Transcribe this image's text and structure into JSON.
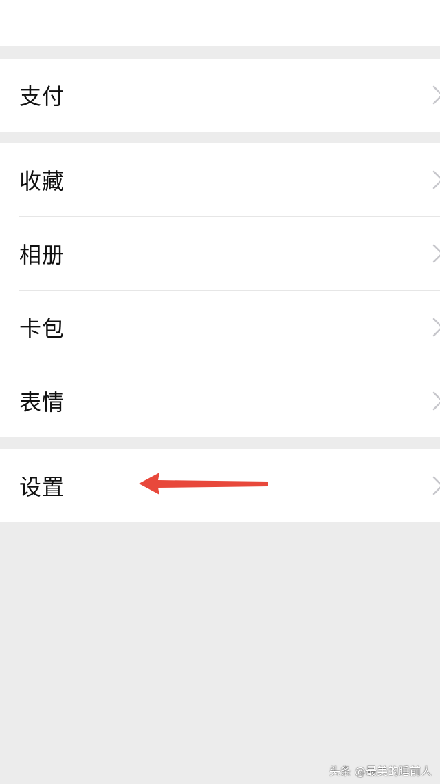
{
  "menu": {
    "pay": "支付",
    "favorites": "收藏",
    "album": "相册",
    "cards": "卡包",
    "stickers": "表情",
    "settings": "设置"
  },
  "watermark": "头条 @最美的睡前人",
  "colors": {
    "background": "#ececec",
    "row_bg": "#ffffff",
    "divider": "#e6e6e6",
    "annotation_arrow": "#e8483b",
    "chevron": "#c7c7cc"
  },
  "icons": {
    "chevron": "chevron-right-icon",
    "annotation": "red-arrow-annotation"
  }
}
